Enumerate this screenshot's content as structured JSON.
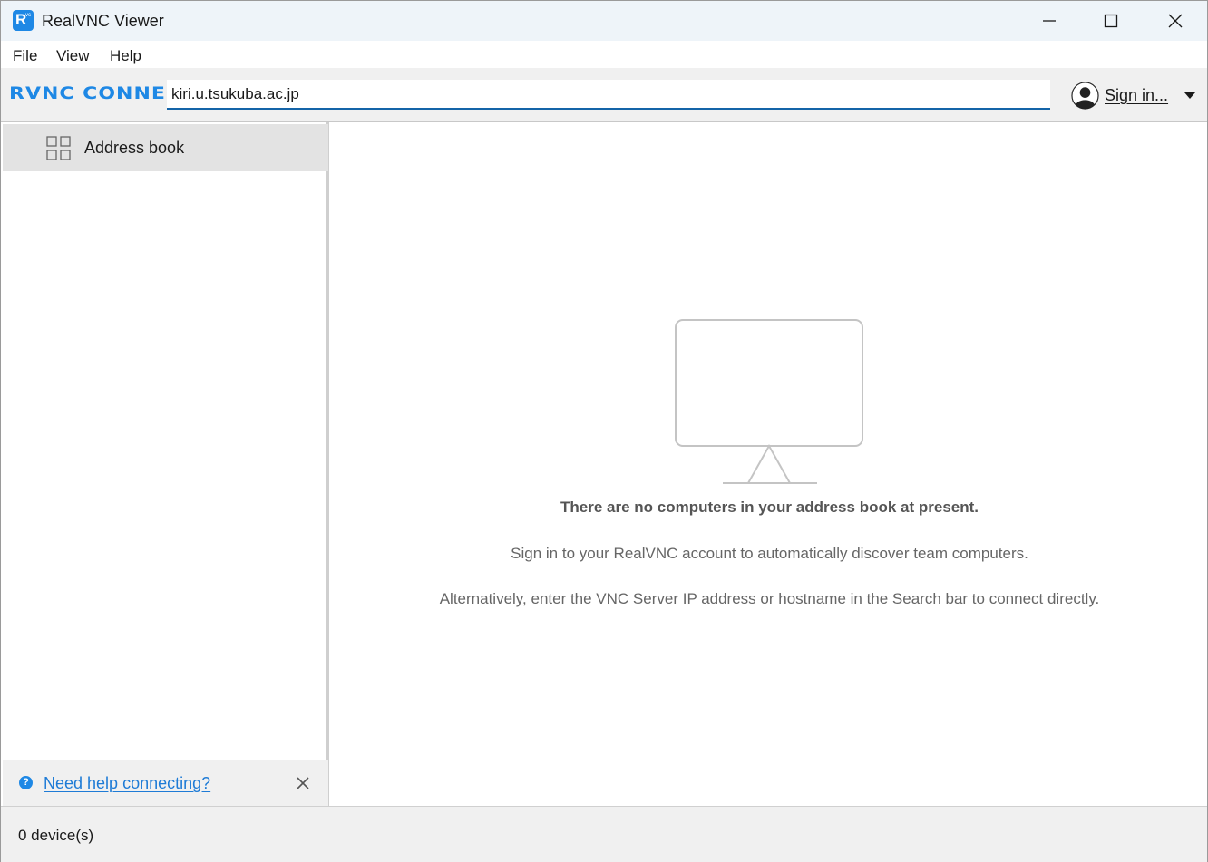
{
  "window": {
    "title": "RealVNC Viewer",
    "icon_name": "realvnc-app-icon",
    "icon_letters": {
      "main": "R",
      "small": "vc"
    }
  },
  "menu": {
    "items": [
      {
        "label": "File"
      },
      {
        "label": "View"
      },
      {
        "label": "Help"
      }
    ]
  },
  "toolbar": {
    "logo_text": "RVNC CONNECT",
    "search_value": "kiri.u.tsukuba.ac.jp",
    "signin_label": "Sign in..."
  },
  "sidebar": {
    "items": [
      {
        "label": "Address book",
        "icon": "grid-icon",
        "selected": true
      }
    ],
    "help_link": "Need help connecting?"
  },
  "main": {
    "empty_title": "There are no computers in your address book at present.",
    "empty_line1": "Sign in to your RealVNC account to automatically discover team computers.",
    "empty_line2": "Alternatively, enter the VNC Server IP address or hostname in the Search bar to connect directly."
  },
  "status": {
    "device_count": "0 device(s)"
  },
  "colors": {
    "accent": "#1e88e5",
    "link": "#1e7bd6",
    "titlebar_bg": "#eef4f9",
    "sidebar_selected": "#e3e3e3"
  }
}
